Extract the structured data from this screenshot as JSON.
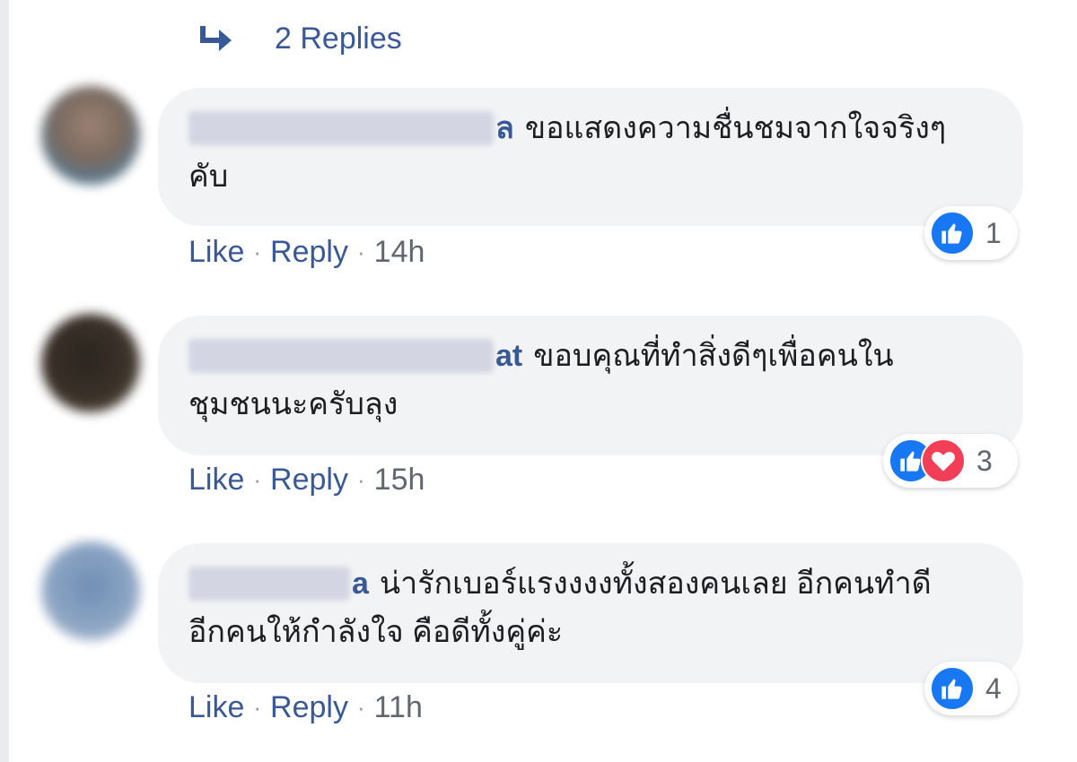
{
  "replies": {
    "label": "2 Replies",
    "icon": "reply-arrow-icon"
  },
  "comments": [
    {
      "author_visible": "ล",
      "text_line1": "ขอแสดงความชื่นชมจากใจจริงๆ",
      "text_line2": "คับ",
      "reaction_count": "1",
      "actions": {
        "like": "Like",
        "reply": "Reply",
        "separator": "·",
        "time": "14h"
      }
    },
    {
      "author_visible": "at",
      "text_line1": "ขอบคุณที่ทำสิ่งดีๆเพื่อคนใน",
      "text_line2": "ชุมชนนะครับลุง",
      "reaction_count": "3",
      "actions": {
        "like": "Like",
        "reply": "Reply",
        "separator": "·",
        "time": "15h"
      }
    },
    {
      "author_visible": "a",
      "text_line1": "น่ารักเบอร์แรงงงงทั้งสองคนเลย อีกคนทำดี",
      "text_line2": "อีกคนให้กำลังใจ คือดีทั้งคู่ค่ะ",
      "reaction_count": "4",
      "actions": {
        "like": "Like",
        "reply": "Reply",
        "separator": "·",
        "time": "11h"
      }
    }
  ],
  "colors": {
    "link": "#385898",
    "bubble": "#f2f3f5",
    "like_blue": "#1877f2",
    "love_red": "#f33e58",
    "meta_gray": "#606770"
  }
}
